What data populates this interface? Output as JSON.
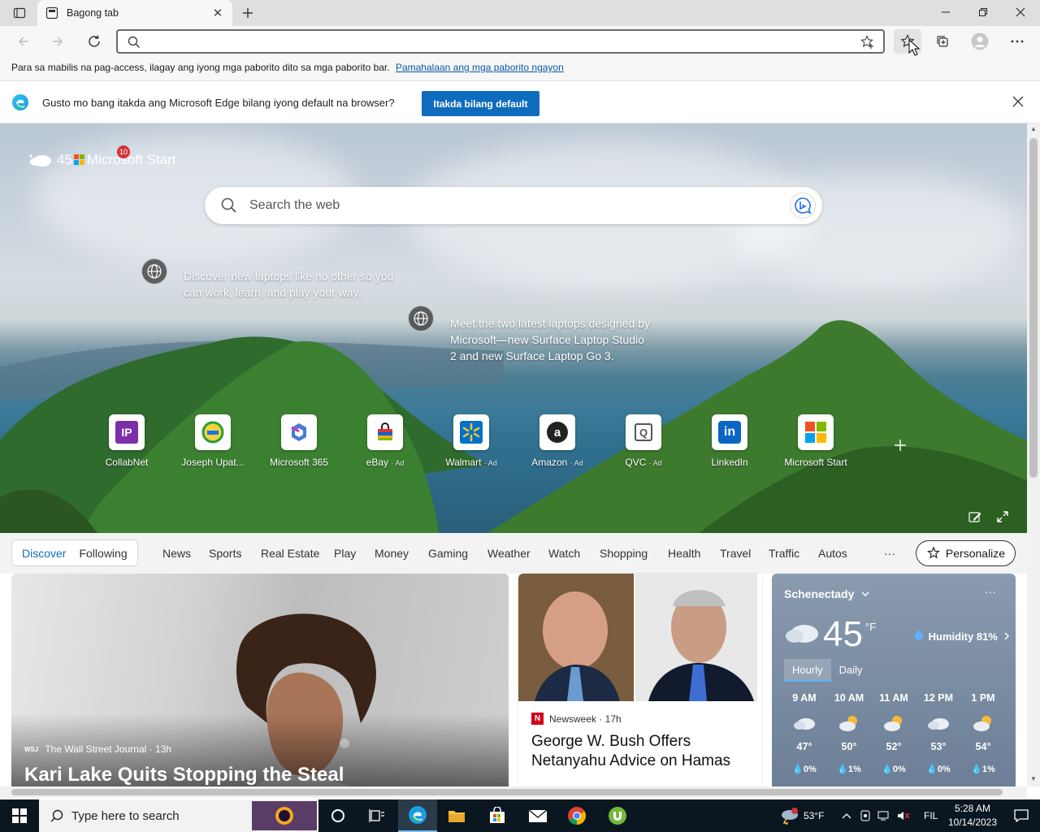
{
  "browser": {
    "tab": {
      "title": "Bagong tab"
    },
    "address": {
      "value": "",
      "placeholder": ""
    }
  },
  "favorites_hint": {
    "text": "Para sa mabilis na pag-access, ilagay ang iyong mga paborito dito sa mga paborito bar.",
    "link": "Pamahalaan ang mga paborito ngayon"
  },
  "infobar": {
    "message": "Gusto mo bang itakda ang Microsoft Edge bilang iyong default na browser?",
    "button": "Itakda bilang default"
  },
  "hero": {
    "weather_temp": "45",
    "brand": "Microsoft Start",
    "notification_count": "10",
    "search_placeholder": "Search the web",
    "promos": [
      {
        "text": "Discover new laptops like no other so you can work, learn, and play your way."
      },
      {
        "text": "Meet the two latest laptops designed by Microsoft—new Surface Laptop Studio 2 and new Surface Laptop Go 3."
      }
    ],
    "tiles": [
      {
        "label": "CollabNet",
        "ad": "",
        "glyph": "IP",
        "color": "#8a3ab9"
      },
      {
        "label": "Joseph Upat...",
        "ad": "",
        "glyph": "●",
        "color": "#2a9d3a"
      },
      {
        "label": "Microsoft 365",
        "ad": "",
        "glyph": "◉",
        "color": "#3b6fd4"
      },
      {
        "label": "eBay",
        "ad": "· Ad",
        "glyph": "🛍",
        "color": "#e53238"
      },
      {
        "label": "Walmart",
        "ad": "· Ad",
        "glyph": "✳",
        "color": "#0071ce"
      },
      {
        "label": "Amazon",
        "ad": "· Ad",
        "glyph": "a",
        "color": "#222222"
      },
      {
        "label": "QVC",
        "ad": "· Ad",
        "glyph": "Q",
        "color": "#555555"
      },
      {
        "label": "LinkedIn",
        "ad": "",
        "glyph": "in",
        "color": "#0a66c2"
      },
      {
        "label": "Microsoft Start",
        "ad": "",
        "glyph": "▦",
        "color": "#f25022"
      }
    ]
  },
  "feed": {
    "tabs": [
      "Discover",
      "Following"
    ],
    "categories": [
      "News",
      "Sports",
      "Real Estate",
      "Play",
      "Money",
      "Gaming",
      "Weather",
      "Watch",
      "Shopping",
      "Health",
      "Travel",
      "Traffic",
      "Autos",
      "···"
    ],
    "personalize": "Personalize",
    "card1": {
      "source": "The Wall Street Journal · 13h",
      "source_logo": "WSJ",
      "headline": "Kari Lake Quits Stopping the Steal"
    },
    "card2": {
      "source": "Newsweek · 17h",
      "source_logo": "N",
      "headline": "George W. Bush Offers Netanyahu Advice on Hamas"
    },
    "weather": {
      "location": "Schenectady",
      "temp": "45",
      "unit": "°F",
      "humidity": "Humidity 81%",
      "toggle": [
        "Hourly",
        "Daily"
      ],
      "hours": [
        {
          "time": "9 AM",
          "temp": "47°",
          "precip": "0%",
          "icon": "cloud-icon"
        },
        {
          "time": "10 AM",
          "temp": "50°",
          "precip": "1%",
          "icon": "partly-sunny-icon"
        },
        {
          "time": "11 AM",
          "temp": "52°",
          "precip": "0%",
          "icon": "partly-sunny-icon"
        },
        {
          "time": "12 PM",
          "temp": "53°",
          "precip": "0%",
          "icon": "cloud-icon"
        },
        {
          "time": "1 PM",
          "temp": "54°",
          "precip": "1%",
          "icon": "partly-sunny-icon"
        }
      ]
    }
  },
  "taskbar": {
    "search_placeholder": "Type here to search",
    "weather": "53°F",
    "language": "FIL",
    "time": "5:28 AM",
    "date": "10/14/2023"
  }
}
